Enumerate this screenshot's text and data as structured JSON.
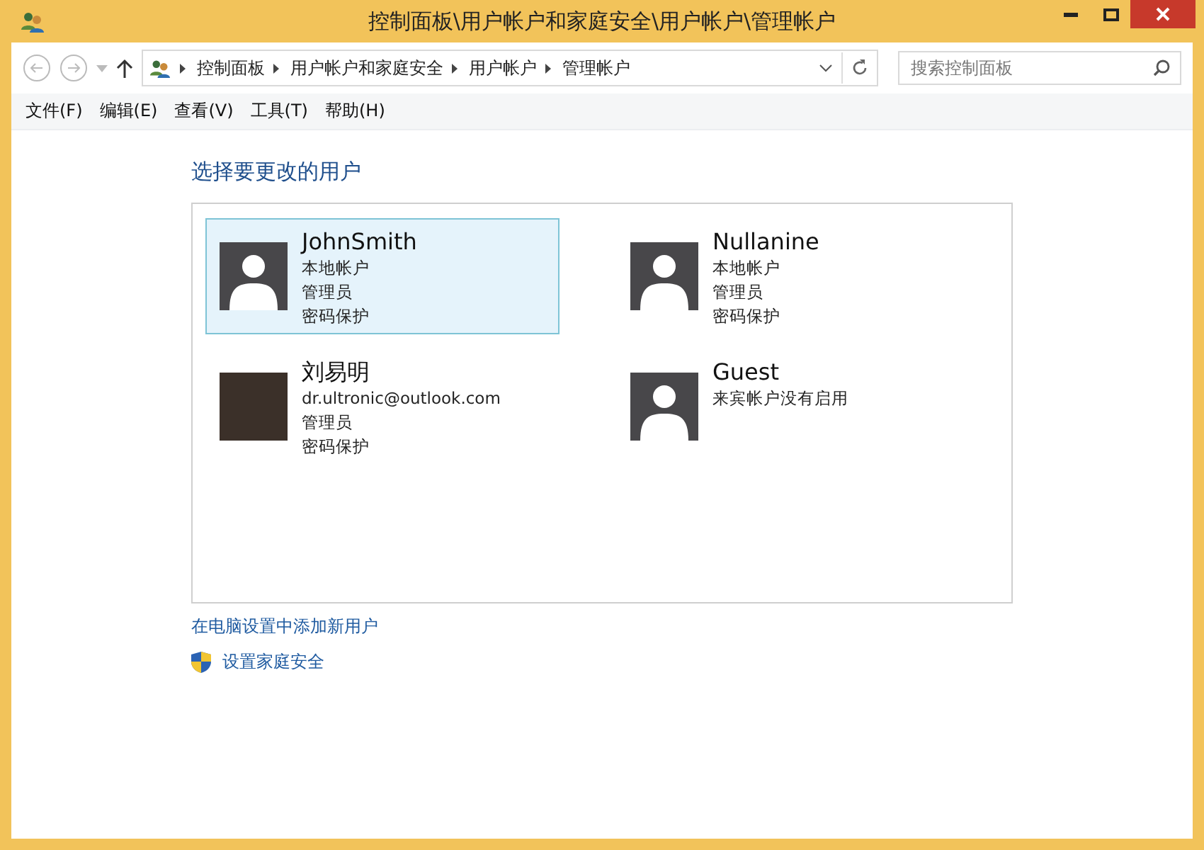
{
  "window": {
    "title": "控制面板\\用户帐户和家庭安全\\用户帐户\\管理帐户"
  },
  "breadcrumbs": [
    "控制面板",
    "用户帐户和家庭安全",
    "用户帐户",
    "管理帐户"
  ],
  "search": {
    "placeholder": "搜索控制面板"
  },
  "menu": [
    "文件(F)",
    "编辑(E)",
    "查看(V)",
    "工具(T)",
    "帮助(H)"
  ],
  "heading": "选择要更改的用户",
  "users": [
    {
      "name": "JohnSmith",
      "kind": "silhouette",
      "selected": true,
      "details": [
        "本地帐户",
        "管理员",
        "密码保护"
      ]
    },
    {
      "name": "Nullanine",
      "kind": "silhouette",
      "selected": false,
      "details": [
        "本地帐户",
        "管理员",
        "密码保护"
      ]
    },
    {
      "name": "刘易明",
      "kind": "photo",
      "selected": false,
      "details": [
        "dr.ultronic@outlook.com",
        "管理员",
        "密码保护"
      ]
    },
    {
      "name": "Guest",
      "kind": "silhouette",
      "selected": false,
      "details": [
        "来宾帐户没有启用"
      ]
    }
  ],
  "links": [
    {
      "kind": "plain",
      "label": "在电脑设置中添加新用户"
    },
    {
      "kind": "shield",
      "label": "设置家庭安全"
    }
  ]
}
